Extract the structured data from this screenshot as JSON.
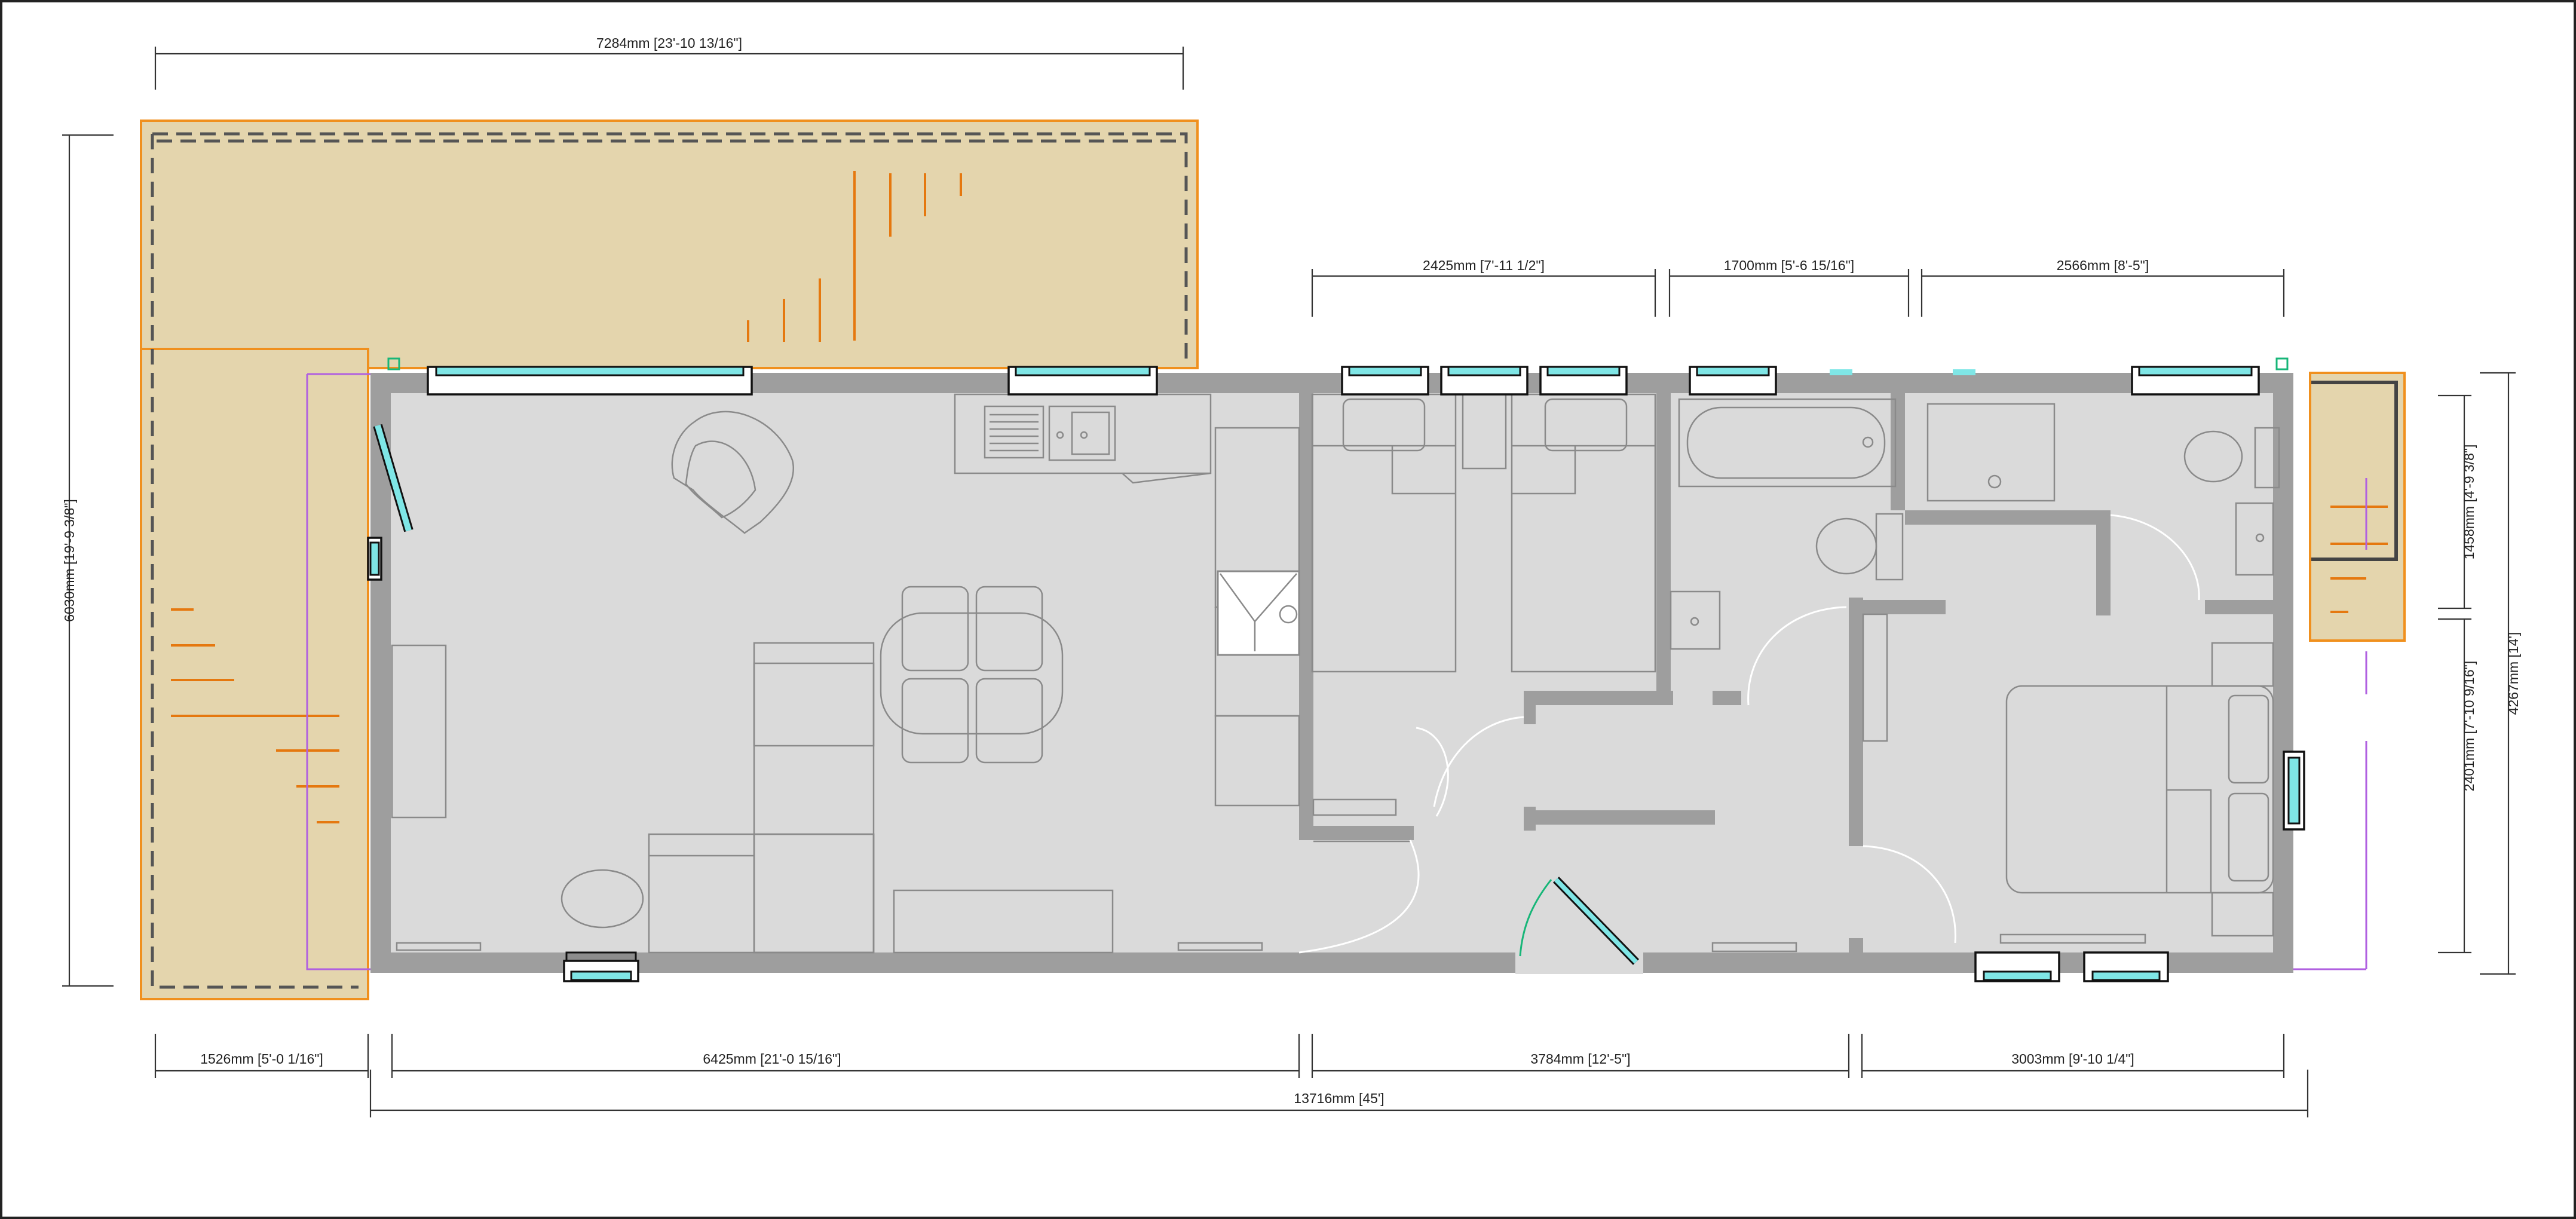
{
  "dimensions": {
    "deck_top_width": "7284mm [23'-10 13/16\"]",
    "bed1_width": "2425mm [7'-11 1/2\"]",
    "bath_width": "1700mm [5'-6 15/16\"]",
    "bed2_top_width": "2566mm [8'-5\"]",
    "deck_left_height": "6030mm [19'-9 3/8\"]",
    "right_upper_height": "1458mm [4'-9 3/8\"]",
    "right_lower_height": "2401mm [7'-10 9/16\"]",
    "overall_height": "4267mm [14']",
    "deck_side_width": "1526mm [5'-0 1/16\"]",
    "living_width": "6425mm [21'-0 15/16\"]",
    "middle_width": "3784mm [12'-5\"]",
    "master_width": "3003mm [9'-10 1/4\"]",
    "overall_length": "13716mm [45']"
  },
  "colors": {
    "deck_fill": "#e4d5ad",
    "deck_outline": "#f0901e",
    "wall": "#9e9e9e",
    "floor": "#dadada",
    "window_glass": "#7fe6e6",
    "boundary_line": "#b060e0",
    "door_swing": "#17b678"
  }
}
